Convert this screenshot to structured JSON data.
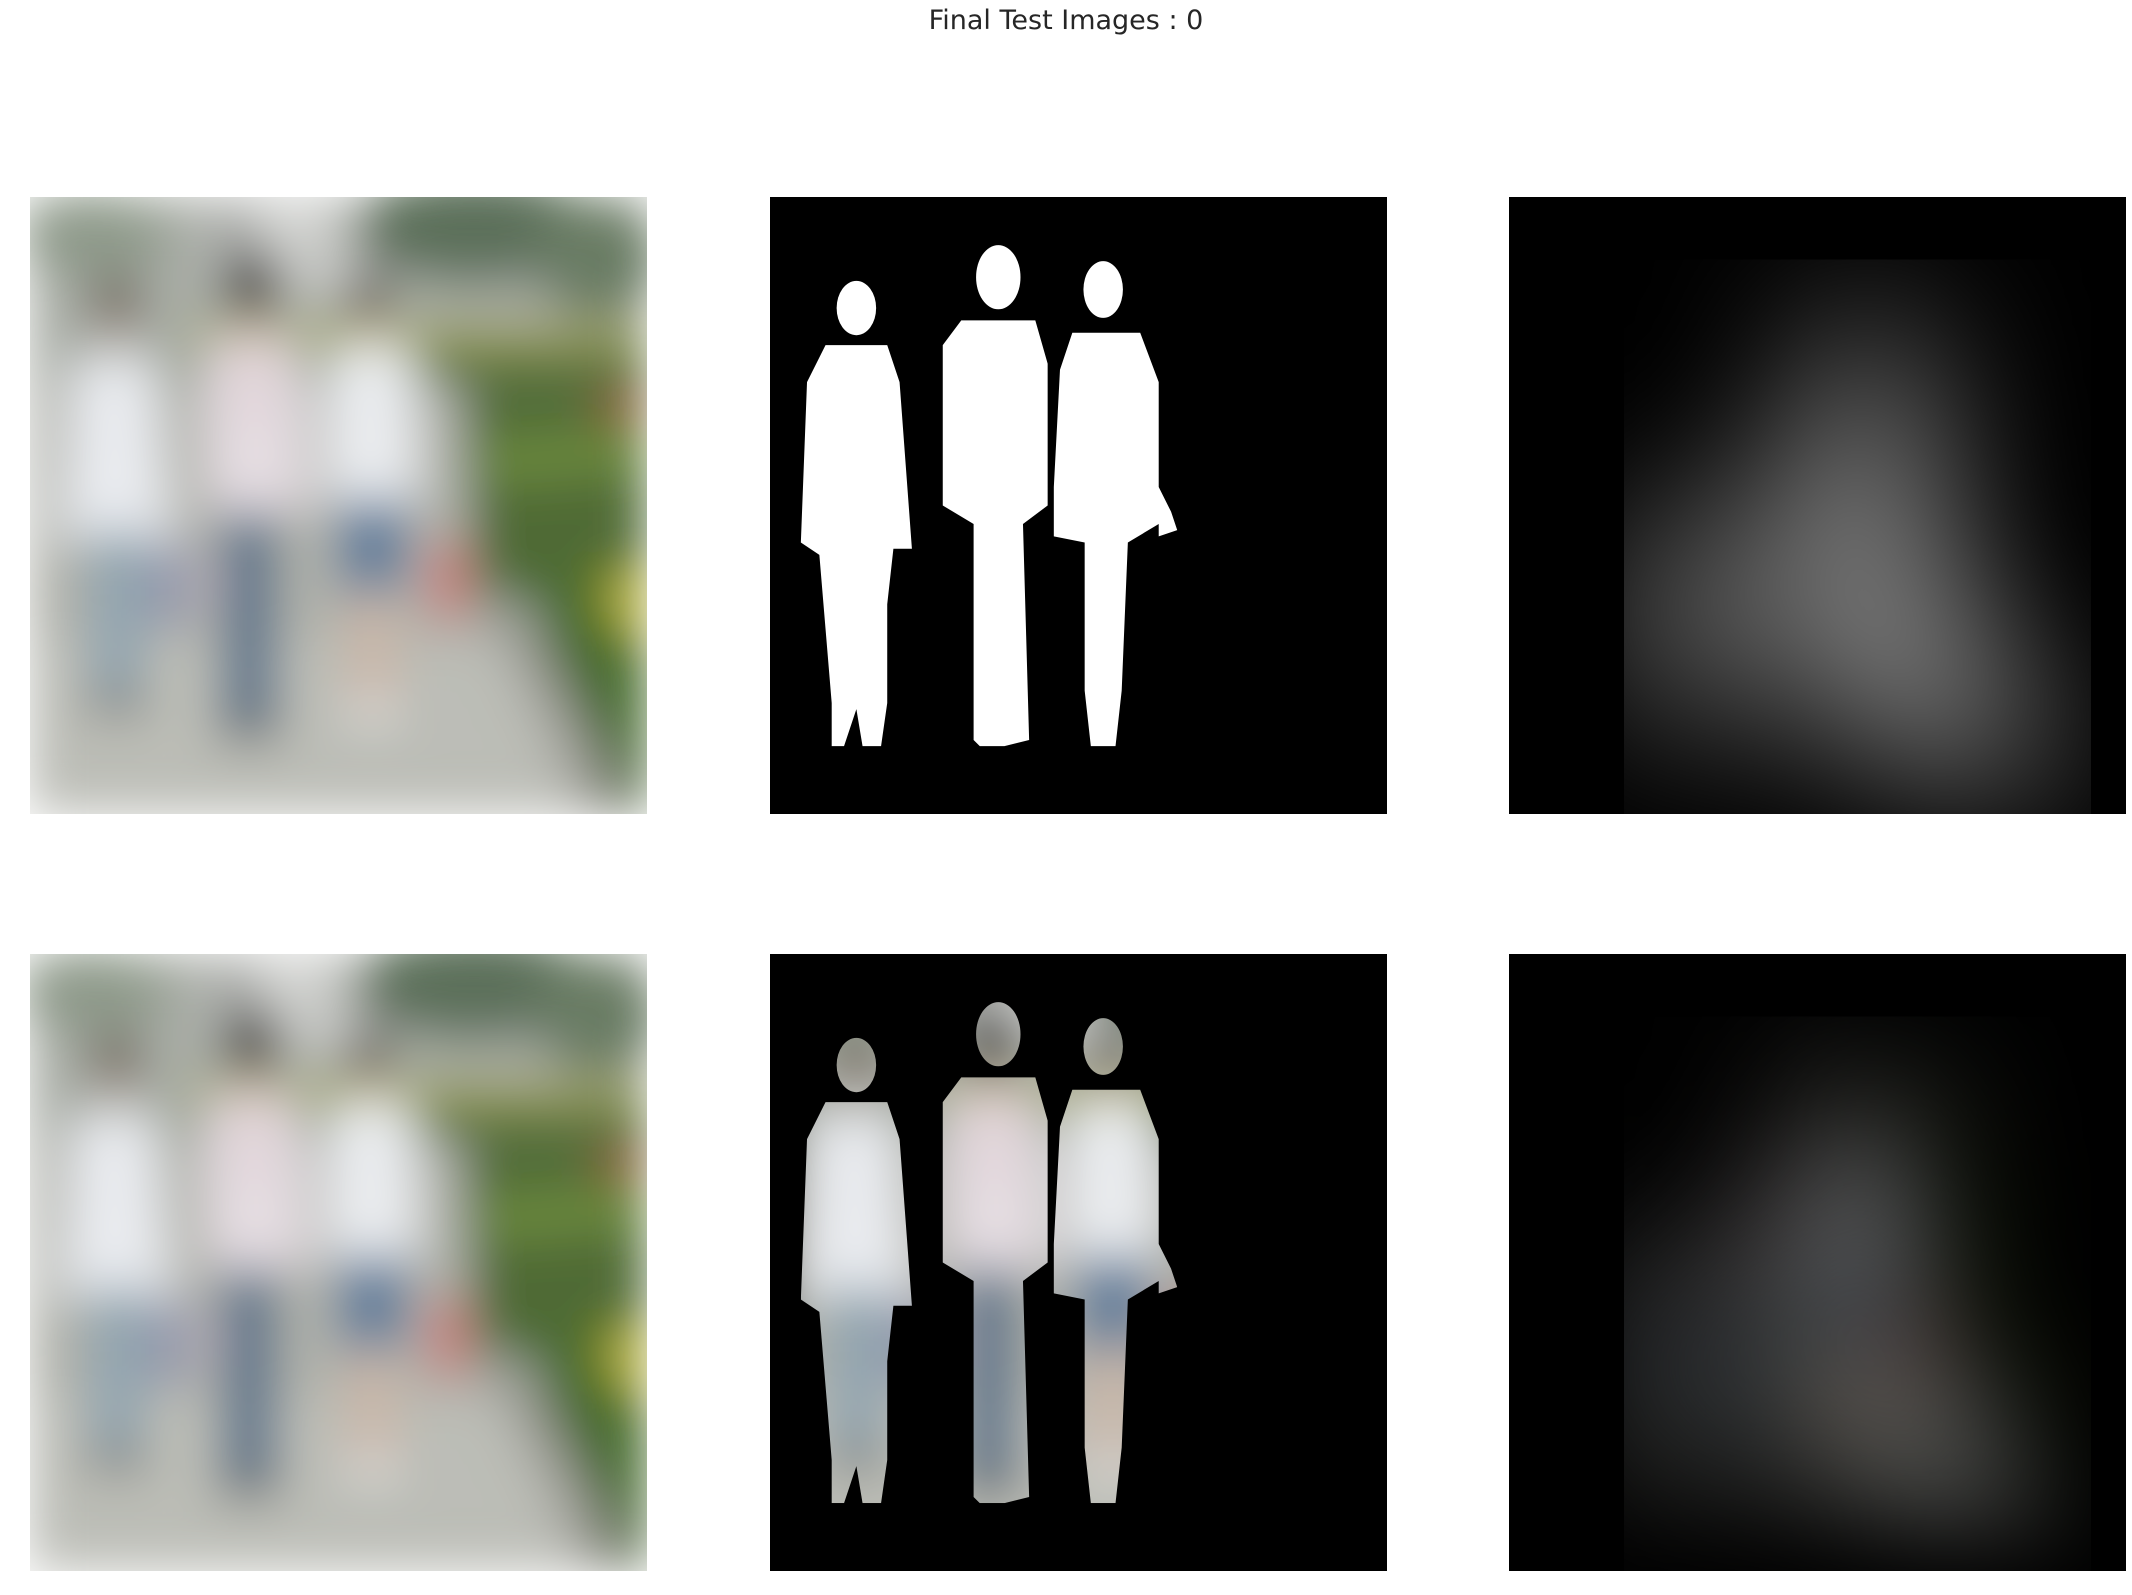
{
  "figure": {
    "title": "Final Test Images : 0"
  },
  "panels": [
    {
      "name": "input-photo",
      "row": 1,
      "col": 1,
      "content": "photo of three people walking on a paved path beside hedges"
    },
    {
      "name": "ground-truth-mask",
      "row": 1,
      "col": 2,
      "content": "white silhouettes of three people on black"
    },
    {
      "name": "predicted-mask",
      "row": 1,
      "col": 3,
      "content": "blurry white predicted mask on black"
    },
    {
      "name": "input-photo-repeat",
      "row": 2,
      "col": 1,
      "content": "same photo of three people walking"
    },
    {
      "name": "ground-truth-masked-photo",
      "row": 2,
      "col": 2,
      "content": "photo masked by ground truth silhouettes"
    },
    {
      "name": "predicted-masked-photo",
      "row": 2,
      "col": 3,
      "content": "photo masked by predicted mask"
    }
  ],
  "colors": {
    "background": "#ffffff",
    "title_text": "#262626",
    "mask_bg": "#000000",
    "mask_fg": "#ffffff"
  }
}
